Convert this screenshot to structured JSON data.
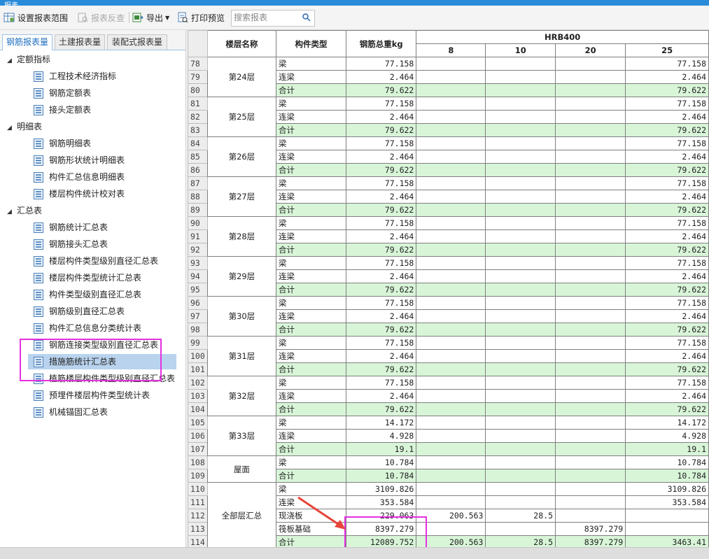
{
  "window": {
    "title": "报表"
  },
  "toolbar": {
    "set_range_label": "设置报表范围",
    "reverse_check_label": "报表反查",
    "export_label": "导出",
    "print_preview_label": "打印预览",
    "search_placeholder": "搜索报表"
  },
  "tabs": [
    {
      "label": "钢筋报表量",
      "active": true
    },
    {
      "label": "土建报表量",
      "active": false
    },
    {
      "label": "装配式报表量",
      "active": false
    }
  ],
  "tree": {
    "groups": [
      {
        "label": "定额指标",
        "items": [
          "工程技术经济指标",
          "钢筋定额表",
          "接头定额表"
        ]
      },
      {
        "label": "明细表",
        "items": [
          "钢筋明细表",
          "钢筋形状统计明细表",
          "构件汇总信息明细表",
          "楼层构件统计校对表"
        ]
      },
      {
        "label": "汇总表",
        "items": [
          "钢筋统计汇总表",
          "钢筋接头汇总表",
          "楼层构件类型级别直径汇总表",
          "楼层构件类型统计汇总表",
          "构件类型级别直径汇总表",
          "钢筋级别直径汇总表",
          "构件汇总信息分类统计表",
          "钢筋连接类型级别直径汇总表",
          "措施筋统计汇总表",
          "植筋楼层构件类型级别直径汇总表",
          "预埋件楼层构件类型统计表",
          "机械锚固汇总表"
        ]
      }
    ],
    "selected": "措施筋统计汇总表"
  },
  "grid": {
    "headers": {
      "floor": "楼层名称",
      "type": "构件类型",
      "total": "钢筋总重kg",
      "grade": "HRB400",
      "diameters": [
        "8",
        "10",
        "20",
        "25"
      ]
    },
    "rows": [
      {
        "rn": "78",
        "floor": "第24层",
        "span": 3,
        "type": "梁",
        "total": "77.158",
        "d8": "",
        "d10": "",
        "d20": "",
        "d25": "77.158",
        "tot": false
      },
      {
        "rn": "79",
        "type": "连梁",
        "total": "2.464",
        "d8": "",
        "d10": "",
        "d20": "",
        "d25": "2.464",
        "tot": false
      },
      {
        "rn": "80",
        "type": "合计",
        "total": "79.622",
        "d8": "",
        "d10": "",
        "d20": "",
        "d25": "79.622",
        "tot": true
      },
      {
        "rn": "81",
        "floor": "第25层",
        "span": 3,
        "type": "梁",
        "total": "77.158",
        "d8": "",
        "d10": "",
        "d20": "",
        "d25": "77.158",
        "tot": false
      },
      {
        "rn": "82",
        "type": "连梁",
        "total": "2.464",
        "d8": "",
        "d10": "",
        "d20": "",
        "d25": "2.464",
        "tot": false
      },
      {
        "rn": "83",
        "type": "合计",
        "total": "79.622",
        "d8": "",
        "d10": "",
        "d20": "",
        "d25": "79.622",
        "tot": true
      },
      {
        "rn": "84",
        "floor": "第26层",
        "span": 3,
        "type": "梁",
        "total": "77.158",
        "d8": "",
        "d10": "",
        "d20": "",
        "d25": "77.158",
        "tot": false
      },
      {
        "rn": "85",
        "type": "连梁",
        "total": "2.464",
        "d8": "",
        "d10": "",
        "d20": "",
        "d25": "2.464",
        "tot": false
      },
      {
        "rn": "86",
        "type": "合计",
        "total": "79.622",
        "d8": "",
        "d10": "",
        "d20": "",
        "d25": "79.622",
        "tot": true
      },
      {
        "rn": "87",
        "floor": "第27层",
        "span": 3,
        "type": "梁",
        "total": "77.158",
        "d8": "",
        "d10": "",
        "d20": "",
        "d25": "77.158",
        "tot": false
      },
      {
        "rn": "88",
        "type": "连梁",
        "total": "2.464",
        "d8": "",
        "d10": "",
        "d20": "",
        "d25": "2.464",
        "tot": false
      },
      {
        "rn": "89",
        "type": "合计",
        "total": "79.622",
        "d8": "",
        "d10": "",
        "d20": "",
        "d25": "79.622",
        "tot": true
      },
      {
        "rn": "90",
        "floor": "第28层",
        "span": 3,
        "type": "梁",
        "total": "77.158",
        "d8": "",
        "d10": "",
        "d20": "",
        "d25": "77.158",
        "tot": false
      },
      {
        "rn": "91",
        "type": "连梁",
        "total": "2.464",
        "d8": "",
        "d10": "",
        "d20": "",
        "d25": "2.464",
        "tot": false
      },
      {
        "rn": "92",
        "type": "合计",
        "total": "79.622",
        "d8": "",
        "d10": "",
        "d20": "",
        "d25": "79.622",
        "tot": true
      },
      {
        "rn": "93",
        "floor": "第29层",
        "span": 3,
        "type": "梁",
        "total": "77.158",
        "d8": "",
        "d10": "",
        "d20": "",
        "d25": "77.158",
        "tot": false
      },
      {
        "rn": "94",
        "type": "连梁",
        "total": "2.464",
        "d8": "",
        "d10": "",
        "d20": "",
        "d25": "2.464",
        "tot": false
      },
      {
        "rn": "95",
        "type": "合计",
        "total": "79.622",
        "d8": "",
        "d10": "",
        "d20": "",
        "d25": "79.622",
        "tot": true
      },
      {
        "rn": "96",
        "floor": "第30层",
        "span": 3,
        "type": "梁",
        "total": "77.158",
        "d8": "",
        "d10": "",
        "d20": "",
        "d25": "77.158",
        "tot": false
      },
      {
        "rn": "97",
        "type": "连梁",
        "total": "2.464",
        "d8": "",
        "d10": "",
        "d20": "",
        "d25": "2.464",
        "tot": false
      },
      {
        "rn": "98",
        "type": "合计",
        "total": "79.622",
        "d8": "",
        "d10": "",
        "d20": "",
        "d25": "79.622",
        "tot": true
      },
      {
        "rn": "99",
        "floor": "第31层",
        "span": 3,
        "type": "梁",
        "total": "77.158",
        "d8": "",
        "d10": "",
        "d20": "",
        "d25": "77.158",
        "tot": false
      },
      {
        "rn": "100",
        "type": "连梁",
        "total": "2.464",
        "d8": "",
        "d10": "",
        "d20": "",
        "d25": "2.464",
        "tot": false
      },
      {
        "rn": "101",
        "type": "合计",
        "total": "79.622",
        "d8": "",
        "d10": "",
        "d20": "",
        "d25": "79.622",
        "tot": true
      },
      {
        "rn": "102",
        "floor": "第32层",
        "span": 3,
        "type": "梁",
        "total": "77.158",
        "d8": "",
        "d10": "",
        "d20": "",
        "d25": "77.158",
        "tot": false
      },
      {
        "rn": "103",
        "type": "连梁",
        "total": "2.464",
        "d8": "",
        "d10": "",
        "d20": "",
        "d25": "2.464",
        "tot": false
      },
      {
        "rn": "104",
        "type": "合计",
        "total": "79.622",
        "d8": "",
        "d10": "",
        "d20": "",
        "d25": "79.622",
        "tot": true
      },
      {
        "rn": "105",
        "floor": "第33层",
        "span": 3,
        "type": "梁",
        "total": "14.172",
        "d8": "",
        "d10": "",
        "d20": "",
        "d25": "14.172",
        "tot": false
      },
      {
        "rn": "106",
        "type": "连梁",
        "total": "4.928",
        "d8": "",
        "d10": "",
        "d20": "",
        "d25": "4.928",
        "tot": false
      },
      {
        "rn": "107",
        "type": "合计",
        "total": "19.1",
        "d8": "",
        "d10": "",
        "d20": "",
        "d25": "19.1",
        "tot": true
      },
      {
        "rn": "108",
        "floor": "屋面",
        "span": 2,
        "type": "梁",
        "total": "10.784",
        "d8": "",
        "d10": "",
        "d20": "",
        "d25": "10.784",
        "tot": false
      },
      {
        "rn": "109",
        "type": "合计",
        "total": "10.784",
        "d8": "",
        "d10": "",
        "d20": "",
        "d25": "10.784",
        "tot": true
      },
      {
        "rn": "110",
        "floor": "全部层汇总",
        "span": 5,
        "type": "梁",
        "total": "3109.826",
        "d8": "",
        "d10": "",
        "d20": "",
        "d25": "3109.826",
        "tot": false
      },
      {
        "rn": "111",
        "type": "连梁",
        "total": "353.584",
        "d8": "",
        "d10": "",
        "d20": "",
        "d25": "353.584",
        "tot": false
      },
      {
        "rn": "112",
        "type": "现浇板",
        "total": "229.063",
        "d8": "200.563",
        "d10": "28.5",
        "d20": "",
        "d25": "",
        "tot": false
      },
      {
        "rn": "113",
        "type": "筏板基础",
        "total": "8397.279",
        "d8": "",
        "d10": "",
        "d20": "8397.279",
        "d25": "",
        "tot": false
      },
      {
        "rn": "114",
        "type": "合计",
        "total": "12089.752",
        "d8": "200.563",
        "d10": "28.5",
        "d20": "8397.279",
        "d25": "3463.41",
        "tot": true
      }
    ]
  },
  "colors": {
    "highlight": "#e430e0",
    "arrow": "#e8443a",
    "total_row": "#d8f5d8",
    "selected_item": "#b9d3ee",
    "accent": "#2a8bd8"
  },
  "icons": [
    "settings-table-icon",
    "reverse-check-icon",
    "export-icon",
    "print-preview-icon",
    "search-icon",
    "collapse-arrow-icon",
    "document-list-icon"
  ]
}
